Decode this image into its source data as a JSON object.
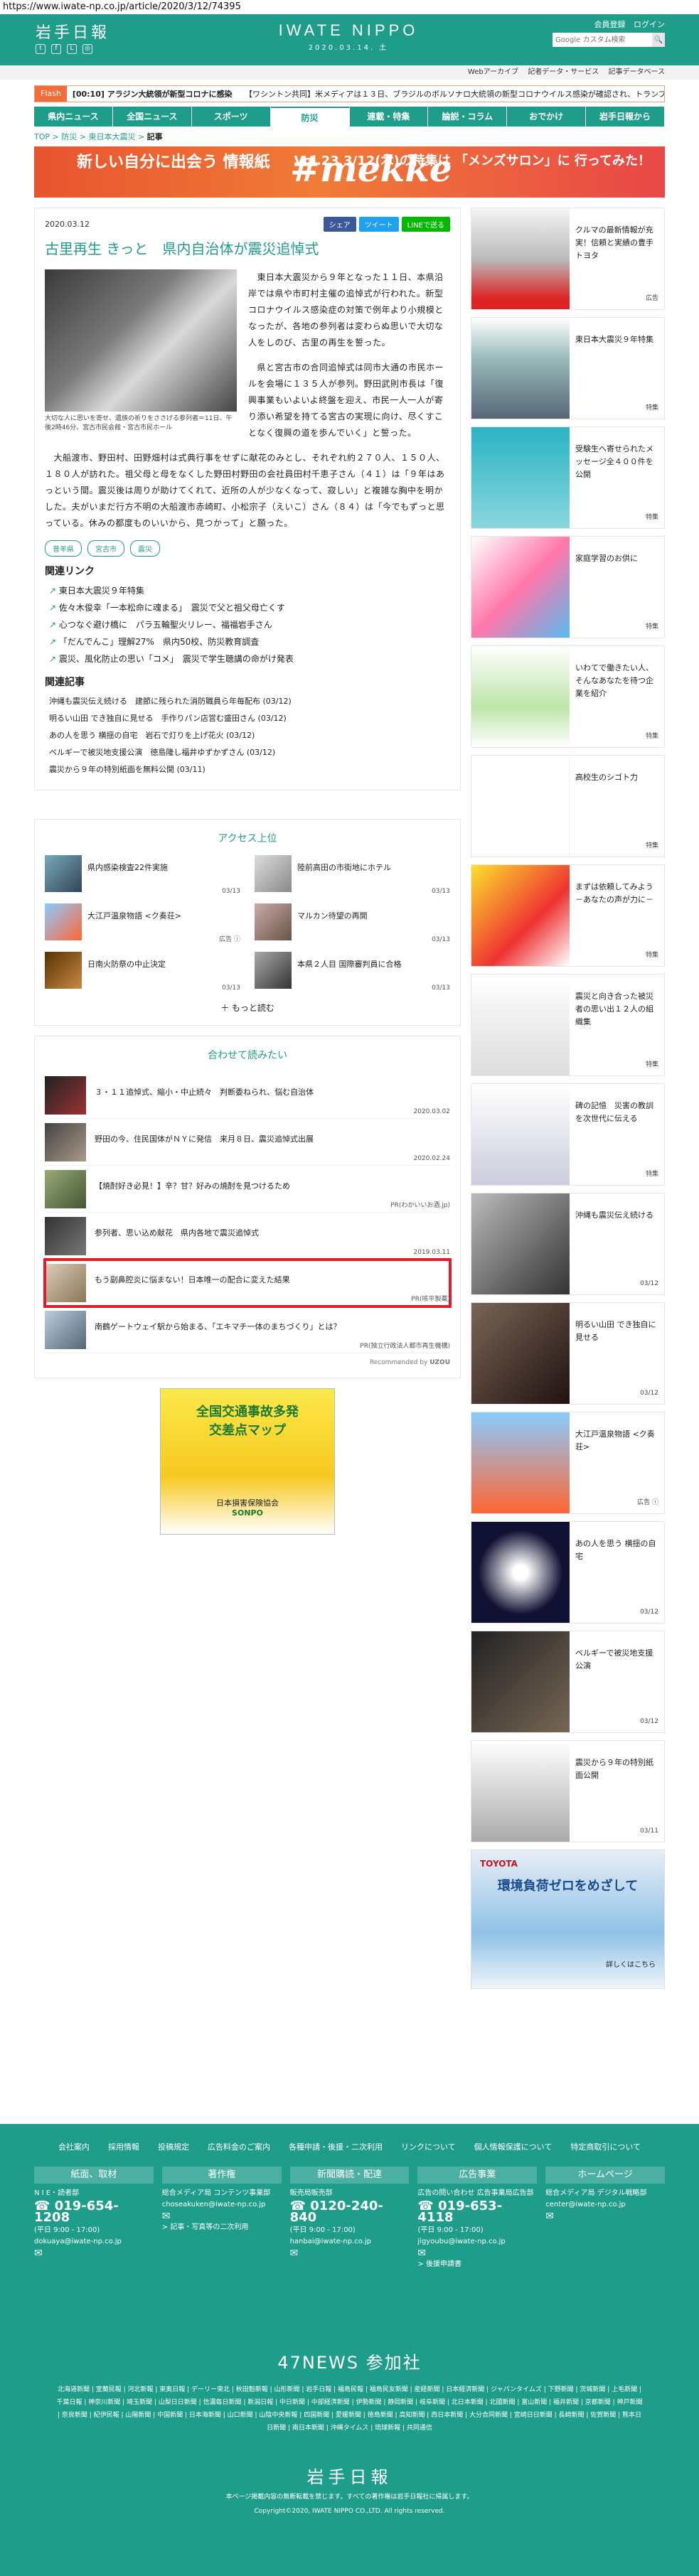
{
  "url": "https://www.iwate-np.co.jp/article/2020/3/12/74395",
  "header": {
    "brand": "岩手日報",
    "logo": "IWATE NIPPO",
    "date": "2020.03.14. 土",
    "member_register": "会員登録",
    "login": "ログイン",
    "search_placeholder": "Google カスタム検索",
    "search_button": "🔍",
    "sub_links": [
      "Webアーカイブ",
      "記者データ・サービス",
      "記事データベース"
    ]
  },
  "flash": {
    "label": "Flash",
    "items": [
      "[00:10] アラジン大統領が新型コロナに感染",
      "【ワシントン共同】米メディアは１３日、ブラジルのボルソナロ大統領の新型コロナウイルス感染が確認され、トランプ米..."
    ]
  },
  "nav": [
    "県内ニュース",
    "全国ニュース",
    "スポーツ",
    "防災",
    "連載・特集",
    "論説・コラム",
    "おでかけ",
    "岩手日報から"
  ],
  "nav_active": 3,
  "breadcrumb": [
    "TOP",
    "防災",
    "東日本大震災",
    "記事"
  ],
  "banner": {
    "left": "新しい自分に出会う 情報紙",
    "middle": "#mekke",
    "right": "Vol.23 3/12(木)の特集は 「メンズサロン」に 行ってみた！"
  },
  "article": {
    "date": "2020.03.12",
    "share": [
      "シェア",
      "ツイート",
      "LINEで送る"
    ],
    "title": "古里再生 きっと　県内自治体が震災追悼式",
    "caption": "大切な人に思いを寄せ、遺族の祈りをささげる参列者＝11日、午後2時46分、宮古市民会館・宮古市民ホール",
    "paragraphs": [
      "　東日本大震災から９年となった１１日、本県沿岸では県や市町村主催の追悼式が行われた。新型コロナウイルス感染症の対策で例年より小規模となったが、各地の参列者は変わらぬ思いで大切な人をしのび、古里の再生を誓った。",
      "　県と宮古市の合同追悼式は同市大通の市民ホールを会場に１３５人が参列。野田武則市長は「復興事業もいよいよ終盤を迎え、市民一人一人が寄り添い希望を持てる宮古の実現に向け、尽くすことなく復興の道を歩んでいく」と誓った。",
      "　大船渡市、野田村、田野畑村は式典行事をせずに献花のみとし、それぞれ約２７０人、１５０人、１８０人が訪れた。祖父母と母をなくした野田村野田の会社員田村千恵子さん（４１）は「９年はあっという間。震災後は周りが助けてくれて、近所の人が少なくなって、寂しい」と複雑な胸中を明かした。夫がいまだ行方不明の大船渡市赤崎町、小松宗子（えいこ）さん（８４）は「今でもずっと思っている。休みの都度ものいいから、見つかって」と願った。"
    ],
    "tags": [
      "普羊県",
      "宮古市",
      "震災"
    ],
    "related_links_heading": "関連リンク",
    "related_links": [
      "東日本大震災９年特集",
      "佐々木俊幸「一本松命に魂まる」　震災で父と祖父母亡くす",
      "心つなぐ避け橋に　パラ五輪聖火リレー、福福岩手さん",
      "「だんでんこ」理解27%　県内50校、防災教育調査",
      "震災、風化防止の思い「コメ」　震災で学生聴講の命がけ発表"
    ],
    "related_articles_heading": "関連記事",
    "related_articles": [
      "沖縄も震災伝え続ける　建節に残られた消防職員ら年毎配布 (03/12)",
      "明るい山田 でき独自に見せる　手作りパン店営む盛田さん (03/12)",
      "あの人を思う 横揺の自宅　岩石で灯りを上げ花火 (03/12)",
      "ベルギーで被災地支援公演　徳島隆し福井ゆずかずさん (03/12)",
      "震災から９年の特別紙面を無料公開 (03/11)"
    ]
  },
  "ranking": {
    "title": "アクセス上位",
    "items": [
      {
        "title": "県内感染検査22件実施",
        "date": "03/13"
      },
      {
        "title": "陸前高田の市街地にホテル",
        "date": "03/13"
      },
      {
        "title": "大江戸温泉物語 <ク奏荘>",
        "date": "広告 ⓘ"
      },
      {
        "title": "マルカン待望の再開",
        "date": "03/13"
      },
      {
        "title": "日南火防祭の中止決定",
        "date": "03/13"
      },
      {
        "title": "本県２人目 国際審判員に合格",
        "date": "03/13"
      }
    ],
    "more": "もっと読む"
  },
  "recommend": {
    "title": "合わせて読みたい",
    "items": [
      {
        "title": "３・１１追悼式、縮小・中止続々　判断委ねられ、悩む自治体",
        "meta": "2020.03.02"
      },
      {
        "title": "野田の今、住民国体がＮＹに発信　来月８日、震災追悼式出展",
        "meta": "2020.02.24"
      },
      {
        "title": "【焼酎好き必見！】辛？甘？好みの焼酎を見つけるため",
        "meta": "PR(わかいいお酒.jp)"
      },
      {
        "title": "参列者、思い込め献花　県内各地で震災追悼式",
        "meta": "2019.03.11"
      },
      {
        "title": "もう副鼻腔炎に悩まない！日本唯一の配合に変えた結果",
        "meta": "PR(咳平製薬)"
      },
      {
        "title": "南鶴ゲートウェイ駅から始まる、「エキマチ一体のまちづくり」とは？",
        "meta": "PR(独立行政法人都市再生機構)"
      }
    ],
    "highlight_index": 4,
    "recommended_by": "Recommended by",
    "vendor": "UZOU"
  },
  "ad_square": {
    "line1": "全国交通事故多発",
    "line2": "交差点マップ",
    "sponsor": "日本損害保険協会",
    "partner": "SONPO"
  },
  "sidebar": [
    {
      "text": "クルマの最新情報が充実！信頼と実績の豊手トヨタ",
      "label": "広告"
    },
    {
      "text": "東日本大震災９年特集",
      "label": "特集"
    },
    {
      "text": "受験生へ寄せられたメッセージ全４００件を公開",
      "label": "特集"
    },
    {
      "text": "家庭学習のお供に",
      "label": "特集"
    },
    {
      "text": "いわてで働きたい人、そんなあなたを待つ企業を紹介",
      "label": "特集"
    },
    {
      "text": "高校生のシゴト力",
      "label": "特集"
    },
    {
      "text": "まずは依頼してみよう－あなたの声が力に－",
      "label": "特集"
    },
    {
      "text": "震災と向き合った被災者の思い出１２人の組織集",
      "label": "特集"
    },
    {
      "text": "碑の記憶　災害の教訓を次世代に伝える",
      "label": "特集"
    },
    {
      "text": "沖縄も震災伝え続ける",
      "label": "03/12"
    },
    {
      "text": "明るい山田 でき独自に見せる",
      "label": "03/12"
    },
    {
      "text": "大江戸温泉物語 <ク奏荘>",
      "label": "広告 ⓘ"
    },
    {
      "text": "あの人を思う 横揺の自宅",
      "label": "03/12"
    },
    {
      "text": "ベルギーで被災地支援公演",
      "label": "03/12"
    },
    {
      "text": "震災から９年の特別紙面公開",
      "label": "03/11"
    }
  ],
  "side_ad": {
    "brand": "TOYOTA",
    "copy": "環境負荷ゼロをめざして",
    "cta": "詳しくはこちら"
  },
  "footer": {
    "links": [
      "会社案内",
      "採用情報",
      "投稿規定",
      "広告料金のご案内",
      "各種申請・後援・二次利用",
      "リンクについて",
      "個人情報保護について",
      "特定商取引について"
    ],
    "cols": [
      {
        "h": "紙面、取材",
        "sub": "N I E・読者部",
        "tel": "019-654-1208",
        "hours": "(平日 9:00 - 17:00)",
        "mail": "dokuaya@iwate-np.co.jp"
      },
      {
        "h": "著作権",
        "sub": "総合メディア局 コンテンツ事業部",
        "tel": "",
        "hours": "",
        "mail": "choseakuken@iwate-np.co.jp"
      },
      {
        "h": "新聞購読・配達",
        "sub": "販売局販売部",
        "tel": "0120-240-840",
        "hours": "(平日 9:00 - 17:00)",
        "mail": "hanbai@iwate-np.co.jp"
      },
      {
        "h": "広告事業",
        "sub": "広告の問い合わせ 広告事業局広告部",
        "tel": "019-653-4118",
        "hours": "(平日 9:00 - 17:00)",
        "mail": "jigyoubu@iwate-np.co.jp"
      },
      {
        "h": "ホームページ",
        "sub": "総合メディア局 デジタル戦略部",
        "tel": "",
        "hours": "",
        "mail": "center@iwate-np.co.jp"
      }
    ],
    "col2_note": "> 記事・写真等の二次利用",
    "col4_note": "> 後援申請書",
    "n47_title": "47NEWS 参加社",
    "papers": "北海道新聞 | 室蘭民報 | 河北新報 | 東奥日報 | デーリー東北 | 秋田魁新報 | 山形新聞 | 岩手日報 | 福島民報 | 福島民友新聞 | 産経新聞 | 日本経済新聞 | ジャパンタイムズ | 下野新聞 | 茨城新聞 | 上毛新聞 | 千葉日報 | 神奈川新聞 | 埼玉新聞 | 山梨日日新聞 | 信濃毎日新聞 | 新潟日報 | 中日新聞 | 中部経済新聞 | 伊勢新聞 | 静岡新聞 | 岐阜新聞 | 北日本新聞 | 北國新聞 | 富山新聞 | 福井新聞 | 京都新聞 | 神戸新聞 | 奈良新聞 | 紀伊民報 | 山陽新聞 | 中国新聞 | 日本海新聞 | 山口新聞 | 山陰中央新報 | 四国新聞 | 愛媛新聞 | 徳島新聞 | 高知新聞 | 西日本新聞 | 大分合同新聞 | 宮崎日日新聞 | 長崎新聞 | 佐賀新聞 | 熊本日日新聞 | 南日本新聞 | 沖縄タイムス | 琉球新報 | 共同通信",
    "brand": "岩手日報",
    "copy_note": "本ページ掲載内容の無断転載を禁じます。すべての著作権は岩手日報社に帰属します。",
    "copyright": "Copyright©2020, IWATE NIPPO CO.,LTD. All rights reserved."
  }
}
